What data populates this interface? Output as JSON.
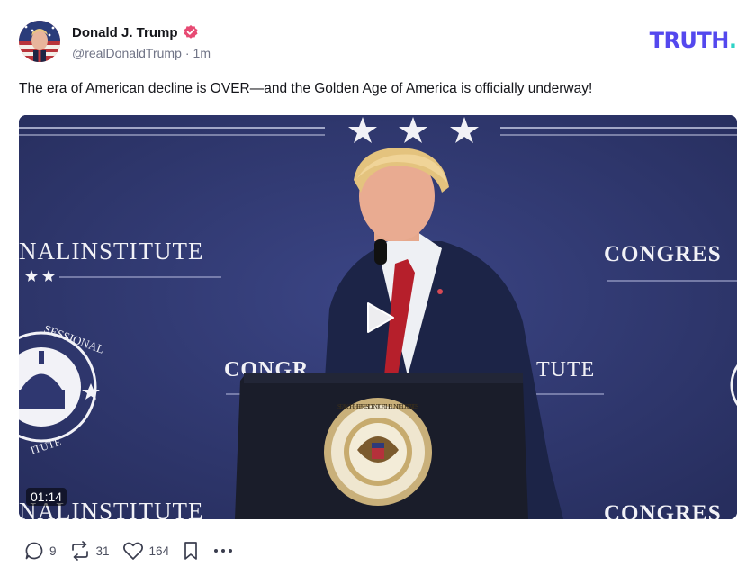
{
  "author": {
    "name": "Donald J. Trump",
    "handle": "@realDonaldTrump",
    "separator": "·",
    "time": "1m",
    "verified_color": "#e74a73"
  },
  "brand": {
    "logo_text": "TRUTH",
    "logo_dot": ".",
    "logo_color": "#5448ee",
    "dot_color": "#2ed3c6"
  },
  "post": {
    "text": "The era of American decline is OVER—and the Golden Age of America is officially underway!"
  },
  "video": {
    "duration": "01:14",
    "backdrop_text_left": "NALINSTITUTE",
    "backdrop_text_right": "CONGRES",
    "backdrop_text_center_left": "CONGR",
    "backdrop_text_center_right": "TUTE",
    "backdrop_text_bottom_left": "NALINSTITUTE",
    "backdrop_text_bottom_right": "CONGRES",
    "seal_ring_text": "SESSIONAL",
    "seal_ring_text_bottom": "ITUTE",
    "podium_seal_text": "SEAL OF THE PRESIDENT OF THE UNITED STATES",
    "backdrop_color": "#2c3468",
    "play_icon": "play-icon"
  },
  "actions": {
    "replies": "9",
    "reposts": "31",
    "likes": "164",
    "icons": [
      "reply-icon",
      "repost-icon",
      "heart-icon",
      "bookmark-icon",
      "more-icon"
    ]
  }
}
